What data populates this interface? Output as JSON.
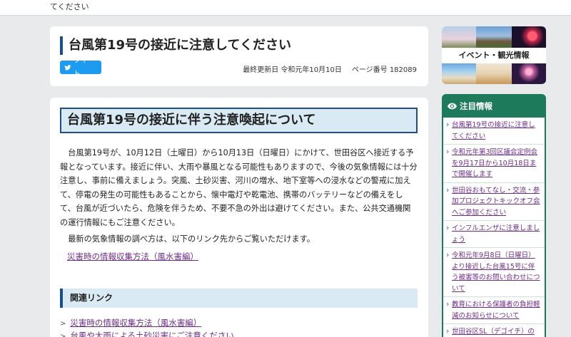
{
  "topbar": {
    "text": "てください"
  },
  "page": {
    "title": "台風第19号の接近に注意してください",
    "tweet_label": "ツイート",
    "updated": "最終更新日 令和元年10月10日",
    "page_number": "ページ番号 182089"
  },
  "main": {
    "heading": "台風第19号の接近に伴う注意喚起について",
    "paragraph1": "台風第19号が、10月12日（土曜日）から10月13日（日曜日）にかけて、世田谷区へ接近する予報となっています。接近に伴い、大雨や暴風となる可能性もありますので、今後の気象情報には十分注意し、事前に備えましょう。突風、土砂災害、河川の増水、地下室等への浸水などの警戒に加えて、停電の発生の可能性もあることから、懐中電灯や乾電池、携帯のバッテリーなどの備えをして、台風が近づいたら、危険を伴うため、不要不急の外出は避けてください。また、公共交通機関の運行情報にもご注意ください。",
    "paragraph2": "最新の気象情報の調べ方は、以下のリンク先からご覧いただけます。",
    "inline_link": "災害時の情報収集方法（風水害編）",
    "related_heading": "関連リンク",
    "related_links": [
      "災害時の情報収集方法（風水害編）",
      "台風や大雨による土砂災害にご注意ください"
    ]
  },
  "banner": {
    "label": "イベント・観光情報"
  },
  "attention": {
    "heading": "注目情報",
    "items": [
      "台風第19号の接近に注意してください",
      "令和元年第3回区議会定例会を9月17日から10月18日まで開催します",
      "世田谷おもてなし・交流・参加プロジェクトキックオフ会へご参加ください",
      "インフルエンザに注意しましょう",
      "令和元年9月8日（日曜日）より接近した台風15号に伴う被害等のお問い合わせについて",
      "教育における保護者の負担軽減のお知らせについて",
      "世田谷区SL（デゴイチ）の"
    ]
  },
  "colors": {
    "accent_blue": "#1a4f8b",
    "heading_bg": "#daeaf5",
    "link_purple": "#6b2d85",
    "attention_green": "#1d7a5a",
    "twitter_blue": "#1d9bf0"
  }
}
